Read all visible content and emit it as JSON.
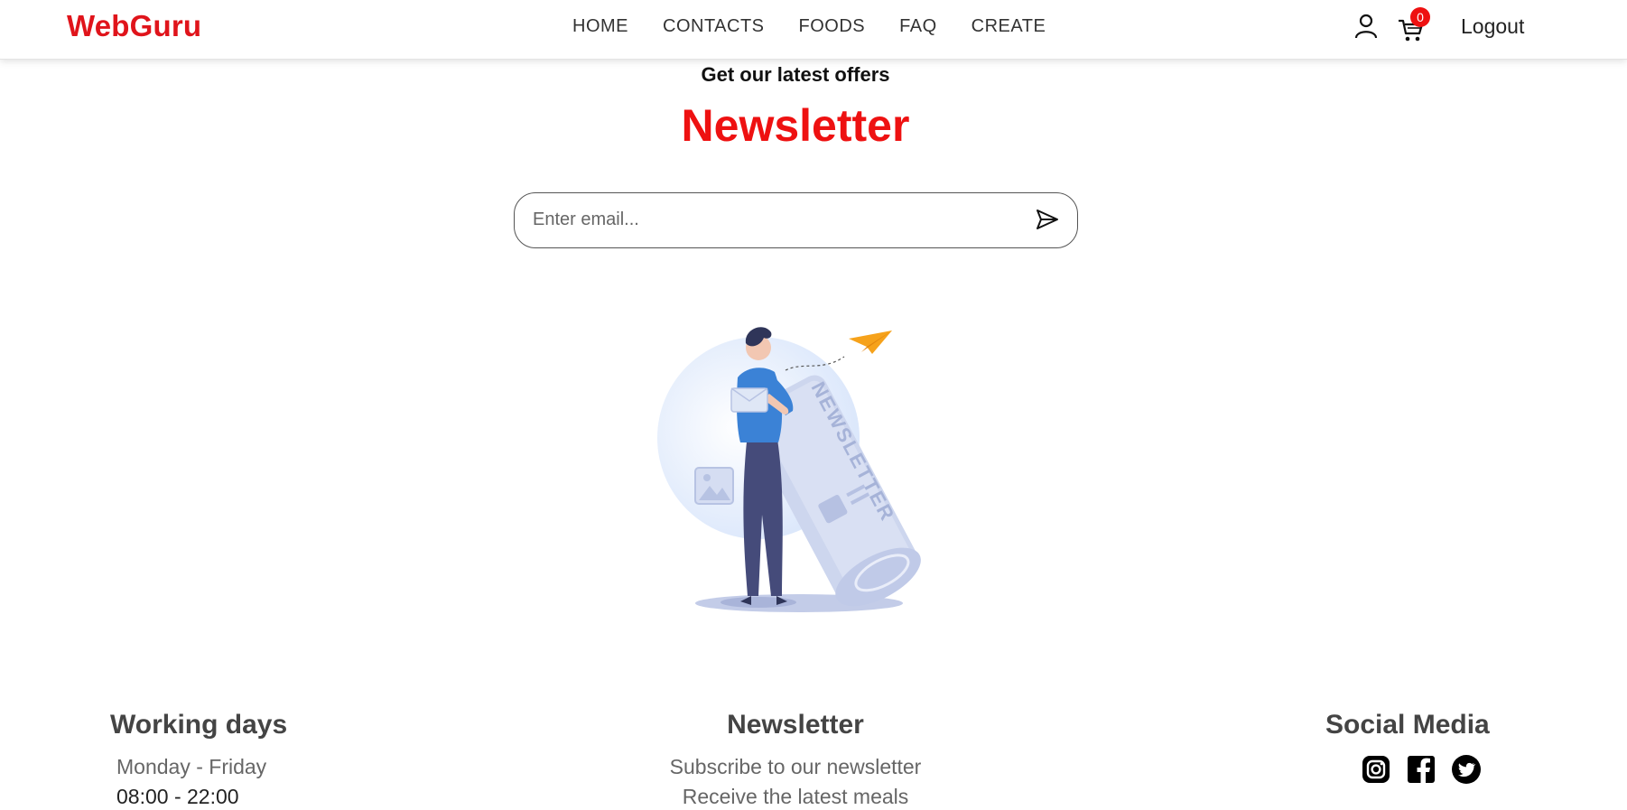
{
  "header": {
    "logo": "WebGuru",
    "nav": [
      "HOME",
      "CONTACTS",
      "FOODS",
      "FAQ",
      "CREATE"
    ],
    "cart_count": "0",
    "logout": "Logout",
    "icons": [
      "user-icon",
      "cart-icon"
    ]
  },
  "hero": {
    "subtitle": "Get our latest offers",
    "title": "Newsletter",
    "email_placeholder": "Enter email...",
    "send_icon": "send-icon",
    "illustration_text": "NEWSLETTER"
  },
  "footer": {
    "working": {
      "title": "Working days",
      "days": "Monday - Friday",
      "hours": "08:00 - 22:00"
    },
    "newsletter": {
      "title": "Newsletter",
      "line1": "Subscribe to our newsletter",
      "line2": "Receive the latest meals"
    },
    "social": {
      "title": "Social Media",
      "icons": [
        "instagram-icon",
        "facebook-icon",
        "twitter-icon"
      ]
    }
  },
  "colors": {
    "brand": "#e0141b",
    "accent": "#ee1111",
    "illustration_blue": "#3b82d6"
  }
}
